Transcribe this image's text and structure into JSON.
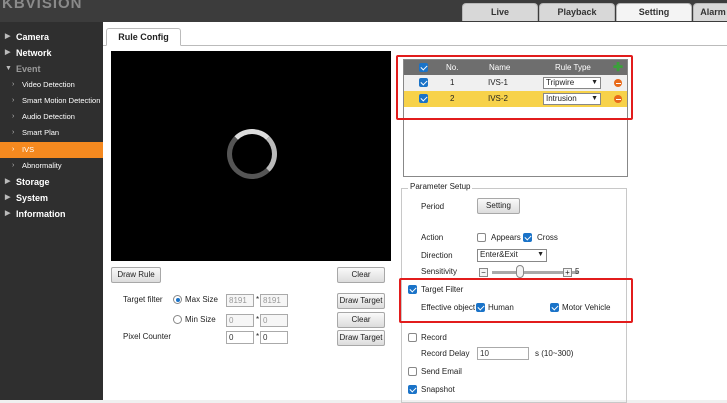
{
  "app": {
    "logo": "KBVISION"
  },
  "top_tabs": [
    "Live",
    "Playback",
    "Setting",
    "Alarm"
  ],
  "sidebar": {
    "camera": "Camera",
    "network": "Network",
    "event": "Event",
    "video_detection": "Video Detection",
    "smart_motion": "Smart Motion Detection",
    "audio_detection": "Audio Detection",
    "smart_plan": "Smart Plan",
    "ivs": "IVS",
    "abnormality": "Abnormality",
    "storage": "Storage",
    "system": "System",
    "information": "Information"
  },
  "content_tab": "Rule Config",
  "left_panel": {
    "draw_rule": "Draw Rule",
    "clear": "Clear",
    "target_filter_label": "Target filter",
    "max_size_label": "Max Size",
    "max_w": "8191",
    "max_h": "8191",
    "times": "*",
    "draw_target": "Draw Target",
    "min_size_label": "Min Size",
    "min_w": "0",
    "min_h": "0",
    "pixel_counter_label": "Pixel Counter",
    "pix_w": "0",
    "pix_h": "0"
  },
  "rule_table": {
    "headers": {
      "no": "No.",
      "name": "Name",
      "rule_type": "Rule Type"
    },
    "rows": [
      {
        "no": "1",
        "name": "IVS-1",
        "rule_type": "Tripwire"
      },
      {
        "no": "2",
        "name": "IVS-2",
        "rule_type": "Intrusion"
      }
    ]
  },
  "params": {
    "legend": "Parameter Setup",
    "period_label": "Period",
    "setting_btn": "Setting",
    "action_label": "Action",
    "appears": "Appears",
    "cross": "Cross",
    "direction_label": "Direction",
    "direction_value": "Enter&Exit",
    "sensitivity_label": "Sensitivity",
    "sensitivity_value": "5",
    "minus_sign": "−",
    "plus_sign": "+",
    "target_filter": "Target Filter",
    "effective_object_label": "Effective object",
    "human": "Human",
    "motor_vehicle": "Motor Vehicle",
    "record": "Record",
    "record_delay_label": "Record Delay",
    "record_delay_value": "10",
    "record_delay_unit": "s (10~300)",
    "send_email": "Send Email",
    "snapshot": "Snapshot"
  },
  "colors": {
    "active_sidebar": "#f5891f",
    "highlight_row": "#f7d24a",
    "annotation": "#e21c1c"
  }
}
